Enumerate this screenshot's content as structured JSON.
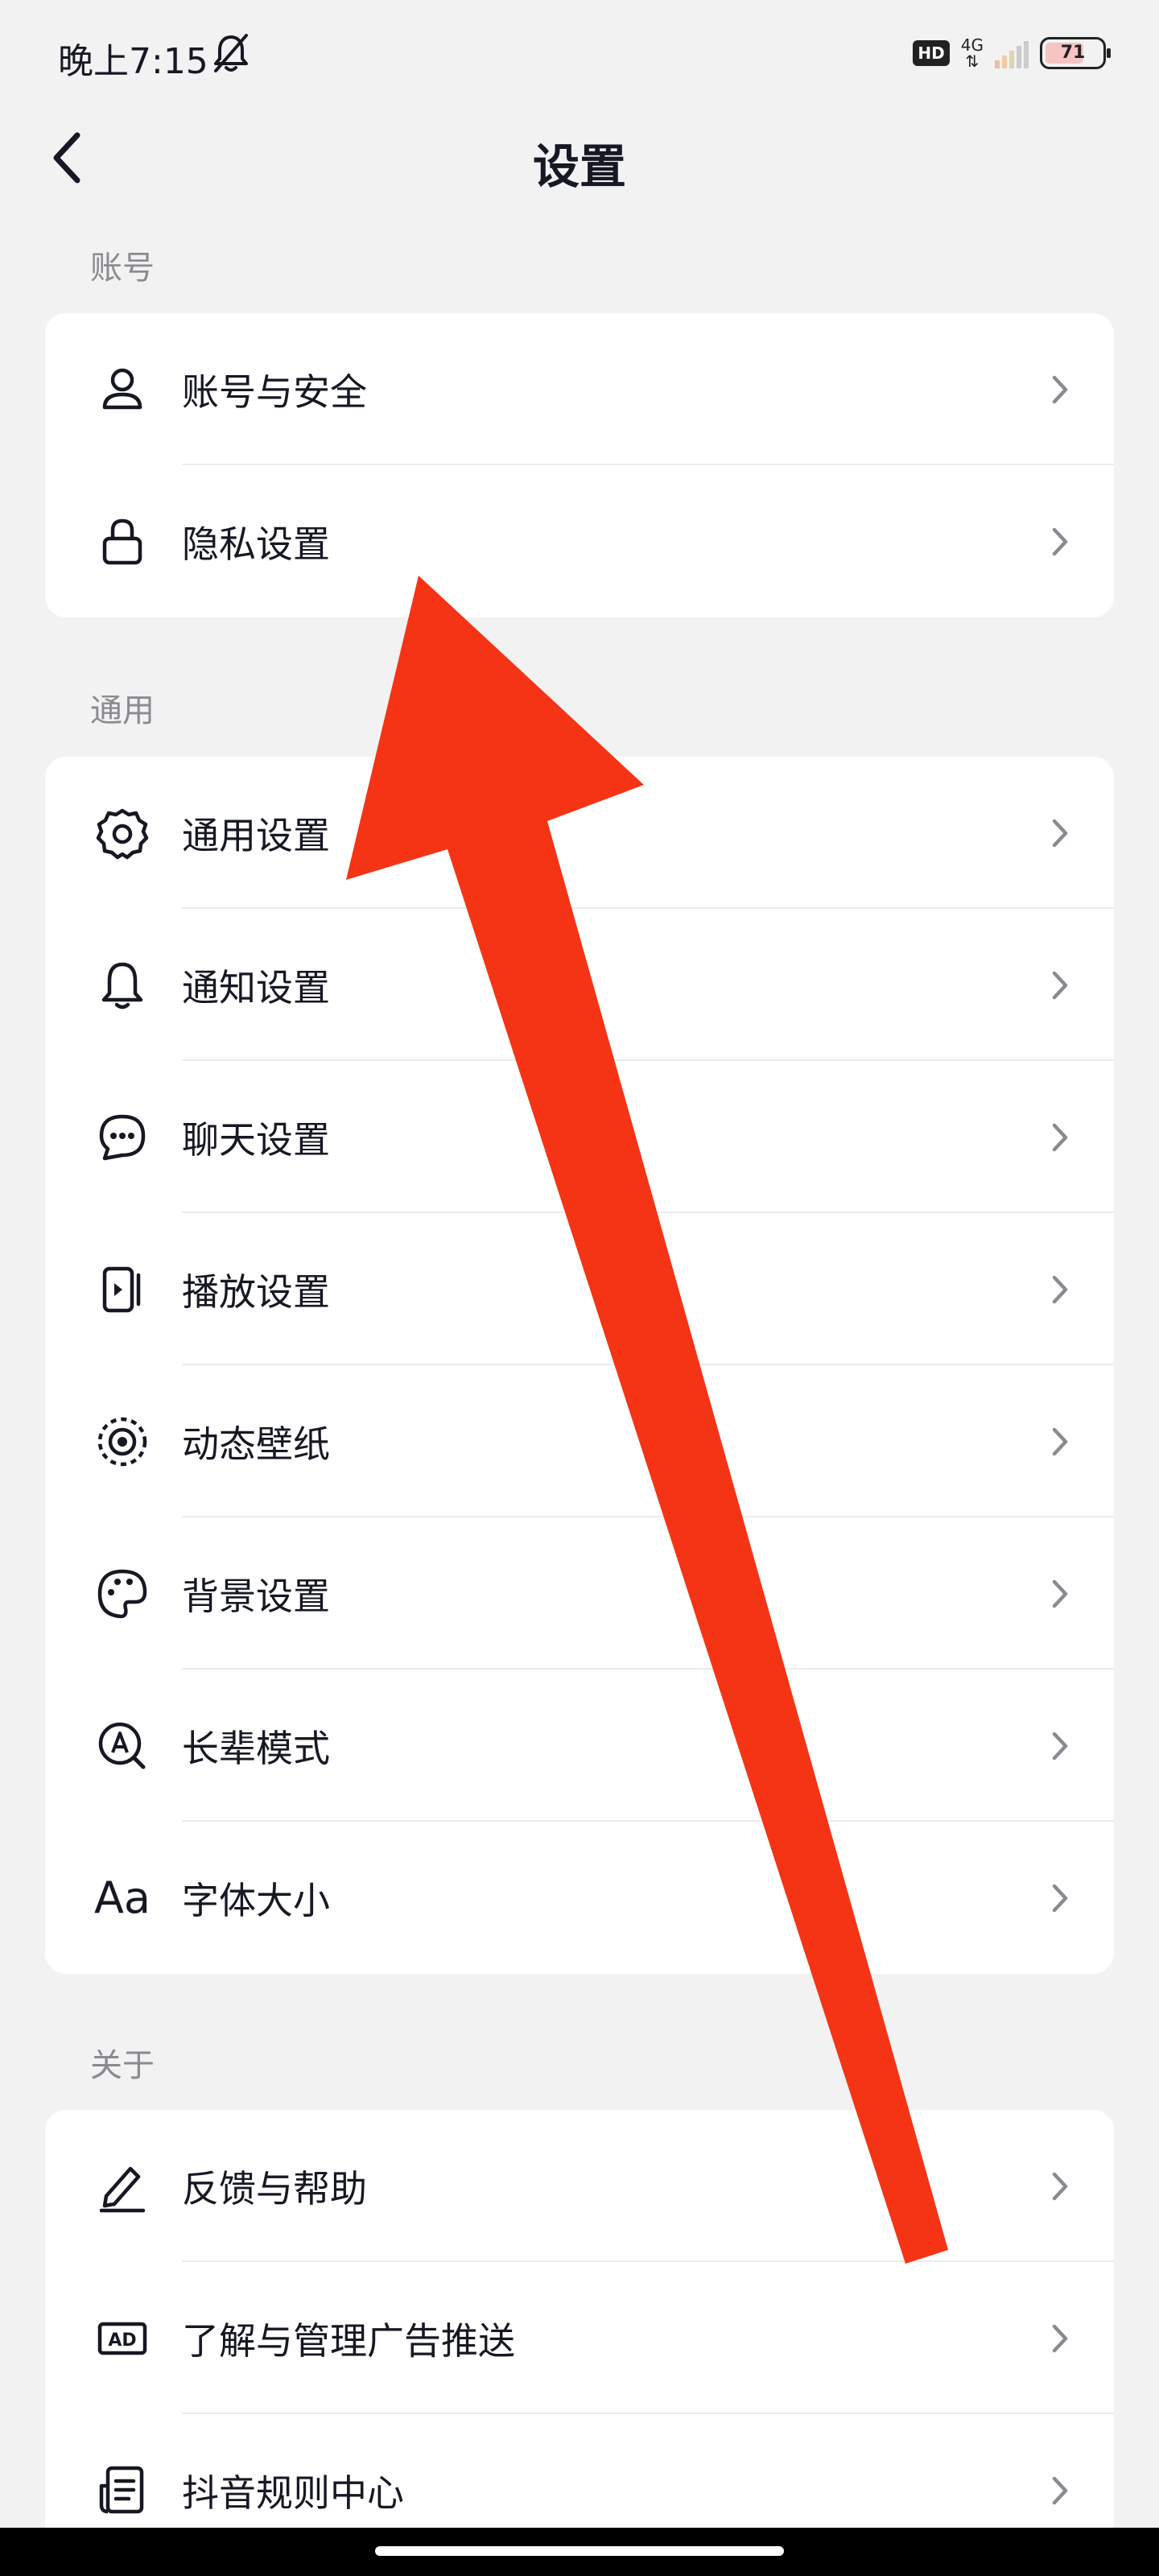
{
  "status_bar": {
    "time": "晚上7:15",
    "hd": "HD",
    "network": "4G",
    "battery": "71"
  },
  "header": {
    "title": "设置"
  },
  "sections": [
    {
      "label": "账号",
      "items": [
        {
          "label": "账号与安全",
          "icon": "user-icon"
        },
        {
          "label": "隐私设置",
          "icon": "lock-icon"
        }
      ]
    },
    {
      "label": "通用",
      "items": [
        {
          "label": "通用设置",
          "icon": "gear-icon"
        },
        {
          "label": "通知设置",
          "icon": "bell-icon"
        },
        {
          "label": "聊天设置",
          "icon": "chat-bubble-icon"
        },
        {
          "label": "播放设置",
          "icon": "play-phone-icon"
        },
        {
          "label": "动态壁纸",
          "icon": "live-wallpaper-icon"
        },
        {
          "label": "背景设置",
          "icon": "palette-icon"
        },
        {
          "label": "长辈模式",
          "icon": "elder-mode-icon"
        },
        {
          "label": "字体大小",
          "icon": "font-size-icon",
          "glyph": "Aa"
        }
      ]
    },
    {
      "label": "关于",
      "items": [
        {
          "label": "反馈与帮助",
          "icon": "pencil-icon"
        },
        {
          "label": "了解与管理广告推送",
          "icon": "ad-icon",
          "glyph": "AD"
        },
        {
          "label": "抖音规则中心",
          "icon": "document-icon"
        }
      ]
    }
  ],
  "colors": {
    "background": "#f2f2f2",
    "card": "#ffffff",
    "text": "#161823",
    "section_label": "#8a8b91",
    "chevron": "#8a8b91",
    "arrow": "#f53415"
  }
}
